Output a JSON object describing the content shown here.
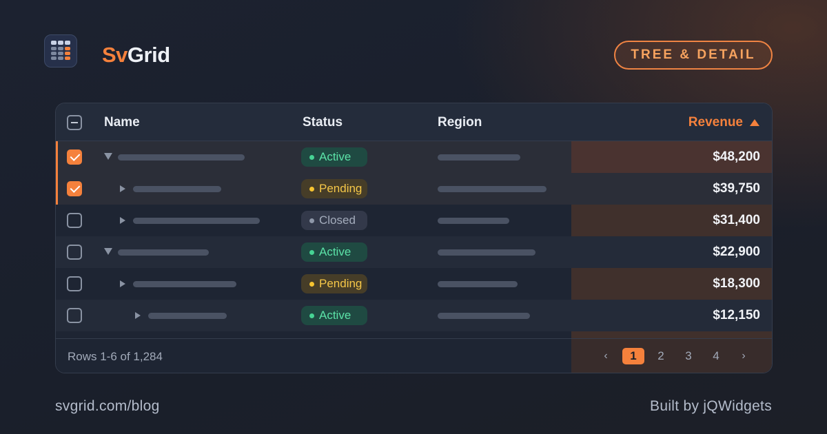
{
  "brand": {
    "prefix": "Sv",
    "suffix": "Grid",
    "icon": "spreadsheet-grid-icon"
  },
  "badge": "TREE & DETAIL",
  "colors": {
    "accent": "#f5813c",
    "active": "#46d394",
    "pending": "#f5c330",
    "closed": "#8e97a8"
  },
  "grid": {
    "columns": [
      "Name",
      "Status",
      "Region",
      "Revenue"
    ],
    "sort": {
      "column": "Revenue",
      "direction": "ascending"
    },
    "rows": [
      {
        "checked": true,
        "tree": "expanded",
        "level": 0,
        "status": "Active",
        "revenue": "$48,200"
      },
      {
        "checked": true,
        "tree": "collapsed",
        "level": 1,
        "status": "Pending",
        "revenue": "$39,750"
      },
      {
        "checked": false,
        "tree": "collapsed",
        "level": 1,
        "status": "Closed",
        "revenue": "$31,400"
      },
      {
        "checked": false,
        "tree": "expanded",
        "level": 0,
        "status": "Active",
        "revenue": "$22,900"
      },
      {
        "checked": false,
        "tree": "collapsed",
        "level": 1,
        "status": "Pending",
        "revenue": "$18,300"
      },
      {
        "checked": false,
        "tree": "collapsed",
        "level": 2,
        "status": "Active",
        "revenue": "$12,150"
      }
    ]
  },
  "pager": {
    "info": "Rows 1-6 of 1,284",
    "prev": "‹",
    "next": "›",
    "pages": [
      "1",
      "2",
      "3",
      "4"
    ],
    "current": "1"
  },
  "footer": {
    "url": "svgrid.com/blog",
    "credit": "Built by jQWidgets"
  }
}
